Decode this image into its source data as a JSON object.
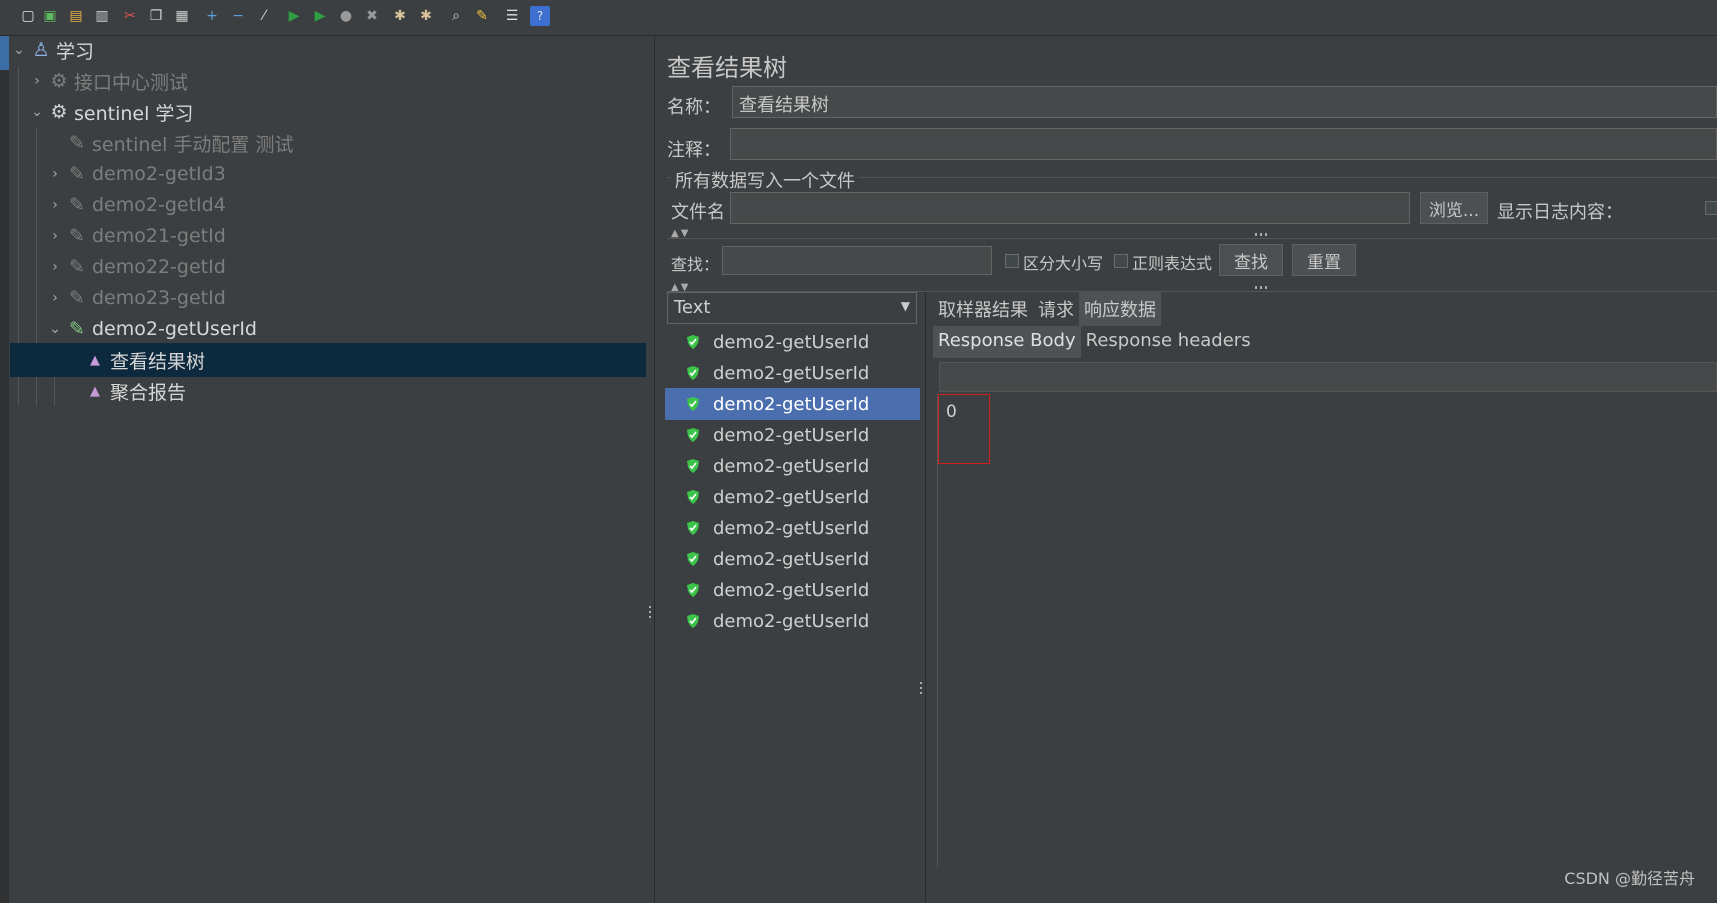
{
  "toolbar": {
    "buttons": [
      {
        "name": "new-icon",
        "glyph": "▢",
        "color": "#e0e0e0"
      },
      {
        "name": "templates-icon",
        "glyph": "▣",
        "color": "#5fb95f"
      },
      {
        "name": "open-icon",
        "glyph": "▤",
        "color": "#e8b04a"
      },
      {
        "name": "save-icon",
        "glyph": "▥",
        "color": "#cfcfcf"
      },
      {
        "name": "cut-icon",
        "glyph": "✂",
        "color": "#e05050"
      },
      {
        "name": "copy-icon",
        "glyph": "❐",
        "color": "#cfcfcf"
      },
      {
        "name": "paste-icon",
        "glyph": "▦",
        "color": "#cfcfcf"
      },
      {
        "name": "expand-icon",
        "glyph": "+",
        "color": "#5fa0e0"
      },
      {
        "name": "collapse-icon",
        "glyph": "−",
        "color": "#5fa0e0"
      },
      {
        "name": "toggle-icon",
        "glyph": "⁄",
        "color": "#cfcfcf"
      },
      {
        "name": "start-icon",
        "glyph": "▶",
        "color": "#2ea043"
      },
      {
        "name": "start-no-pause-icon",
        "glyph": "▶",
        "color": "#2ea043"
      },
      {
        "name": "stop-icon",
        "glyph": "●",
        "color": "#9a9a9a"
      },
      {
        "name": "shutdown-icon",
        "glyph": "✖",
        "color": "#9a9a9a"
      },
      {
        "name": "clear-icon",
        "glyph": "✱",
        "color": "#d8c29a"
      },
      {
        "name": "clear-all-icon",
        "glyph": "✱",
        "color": "#d8c29a"
      },
      {
        "name": "search-icon",
        "glyph": "⌕",
        "color": "#cfcfcf"
      },
      {
        "name": "reset-search-icon",
        "glyph": "✎",
        "color": "#f0c040"
      },
      {
        "name": "function-helper-icon",
        "glyph": "☰",
        "color": "#e0e0e0"
      },
      {
        "name": "help-icon",
        "glyph": "?",
        "color": "#e0e0e0"
      }
    ]
  },
  "tree": {
    "items": [
      {
        "label": "学习",
        "level": 0,
        "twisty": "⌄",
        "icon": "flask-icon",
        "style": "bright",
        "selected": false
      },
      {
        "label": "接口中心测试",
        "level": 1,
        "twisty": "›",
        "icon": "gear-icon",
        "style": "dim",
        "selected": false
      },
      {
        "label": "sentinel 学习",
        "level": 1,
        "twisty": "⌄",
        "icon": "gear-icon",
        "style": "bright",
        "selected": false
      },
      {
        "label": "sentinel 手动配置 测试",
        "level": 2,
        "twisty": "",
        "icon": "pencil-icon",
        "style": "dim",
        "selected": false
      },
      {
        "label": "demo2-getId3",
        "level": 2,
        "twisty": "›",
        "icon": "pencil-icon",
        "style": "dim",
        "selected": false
      },
      {
        "label": "demo2-getId4",
        "level": 2,
        "twisty": "›",
        "icon": "pencil-icon",
        "style": "dim",
        "selected": false
      },
      {
        "label": "demo21-getId",
        "level": 2,
        "twisty": "›",
        "icon": "pencil-icon",
        "style": "dim",
        "selected": false
      },
      {
        "label": "demo22-getId",
        "level": 2,
        "twisty": "›",
        "icon": "pencil-icon",
        "style": "dim",
        "selected": false
      },
      {
        "label": "demo23-getId",
        "level": 2,
        "twisty": "›",
        "icon": "pencil-icon",
        "style": "dim",
        "selected": false
      },
      {
        "label": "demo2-getUserId",
        "level": 2,
        "twisty": "⌄",
        "icon": "pencil-icon",
        "style": "bright",
        "selected": false
      },
      {
        "label": "查看结果树",
        "level": 3,
        "twisty": "",
        "icon": "chart-icon",
        "style": "bright",
        "selected": true
      },
      {
        "label": "聚合报告",
        "level": 3,
        "twisty": "",
        "icon": "chart-icon",
        "style": "bright",
        "selected": false
      }
    ]
  },
  "panel": {
    "title": "查看结果树",
    "name_label": "名称：",
    "name_value": "查看结果树",
    "comment_label": "注释：",
    "comment_value": "",
    "file_section_title": "所有数据写入一个文件",
    "filename_label": "文件名",
    "filename_value": "",
    "browse_button": "浏览...",
    "log_label": "显示日志内容：",
    "search_label": "查找：",
    "search_value": "",
    "case_label": "区分大小写",
    "regex_label": "正则表达式",
    "find_button": "查找",
    "reset_button": "重置"
  },
  "results": {
    "renderer": "Text",
    "items": [
      {
        "label": "demo2-getUserId",
        "selected": false
      },
      {
        "label": "demo2-getUserId",
        "selected": false
      },
      {
        "label": "demo2-getUserId",
        "selected": true
      },
      {
        "label": "demo2-getUserId",
        "selected": false
      },
      {
        "label": "demo2-getUserId",
        "selected": false
      },
      {
        "label": "demo2-getUserId",
        "selected": false
      },
      {
        "label": "demo2-getUserId",
        "selected": false
      },
      {
        "label": "demo2-getUserId",
        "selected": false
      },
      {
        "label": "demo2-getUserId",
        "selected": false
      },
      {
        "label": "demo2-getUserId",
        "selected": false
      }
    ]
  },
  "detail": {
    "tabs": [
      "取样器结果",
      "请求",
      "响应数据"
    ],
    "active_tab": 2,
    "subtabs": [
      "Response Body",
      "Response headers"
    ],
    "active_subtab": 0,
    "response_body": "0"
  },
  "watermark": "CSDN @勤径苦舟"
}
